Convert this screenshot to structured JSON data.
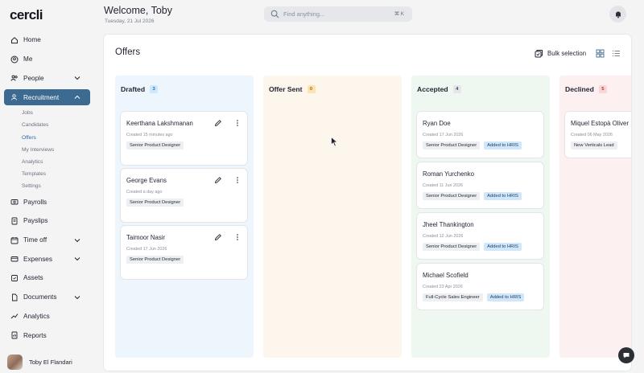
{
  "app": {
    "logo": "cercli"
  },
  "sidebar": {
    "items": [
      {
        "label": "Home"
      },
      {
        "label": "Me"
      },
      {
        "label": "People"
      },
      {
        "label": "Recruitment"
      },
      {
        "label": "Payrolls"
      },
      {
        "label": "Payslips"
      },
      {
        "label": "Time off"
      },
      {
        "label": "Expenses"
      },
      {
        "label": "Assets"
      },
      {
        "label": "Documents"
      },
      {
        "label": "Analytics"
      },
      {
        "label": "Reports"
      }
    ],
    "recruitment_sub": [
      "Jobs",
      "Candidates",
      "Offers",
      "My Interviews",
      "Analytics",
      "Templates",
      "Settings"
    ],
    "user_name": "Toby El Flandari"
  },
  "header": {
    "welcome": "Welcome, Toby",
    "date": "Tuesday, 21 Jul 2026",
    "search_placeholder": "Find anything...",
    "search_shortcut": "⌘ K"
  },
  "page": {
    "title": "Offers",
    "bulk_selection": "Bulk selection"
  },
  "columns": [
    {
      "title": "Drafted",
      "count": "3",
      "bg": "#edf5fd",
      "badge_bg": "#cfe6fb",
      "badge_fg": "#2f67a8",
      "cards": [
        {
          "name": "Keerthana Lakshmanan",
          "meta": "Created 15 minutes ago",
          "role": "Senior Product Designer"
        },
        {
          "name": "George Evans",
          "meta": "Created a day ago",
          "role": "Senior Product Designer"
        },
        {
          "name": "Taimoor Nasir",
          "meta": "Created 17 Jun 2026",
          "role": "Senior Product Designer"
        }
      ]
    },
    {
      "title": "Offer Sent",
      "count": "0",
      "bg": "#fdf6ec",
      "badge_bg": "#fde3b4",
      "badge_fg": "#a86a12",
      "cards": []
    },
    {
      "title": "Accepted",
      "count": "4",
      "bg": "#eef8f1",
      "badge_bg": "#e4e6ea",
      "badge_fg": "#3c4250",
      "cards": [
        {
          "name": "Ryan Doe",
          "meta": "Created 17 Jun 2026",
          "role": "Senior Product Designer",
          "status": "Added to HRIS"
        },
        {
          "name": "Roman Yurchenko",
          "meta": "Created 11 Jun 2026",
          "role": "Senior Product Designer",
          "status": "Added to HRIS"
        },
        {
          "name": "Jheel Thankington",
          "meta": "Created 12 Jun 2026",
          "role": "Senior Product Designer",
          "status": "Added to HRIS"
        },
        {
          "name": "Michael Scofield",
          "meta": "Created 23 Apr 2026",
          "role": "Full-Cycle Sales Engineer",
          "status": "Added to HRIS"
        }
      ]
    },
    {
      "title": "Declined",
      "count": "5",
      "bg": "#fdf0f0",
      "badge_bg": "#fbd5d5",
      "badge_fg": "#b03535",
      "cards": [
        {
          "name": "Miquel Estopà Oliver",
          "meta": "Created 06 May 2026",
          "role": "New Verticals Lead"
        }
      ]
    }
  ]
}
